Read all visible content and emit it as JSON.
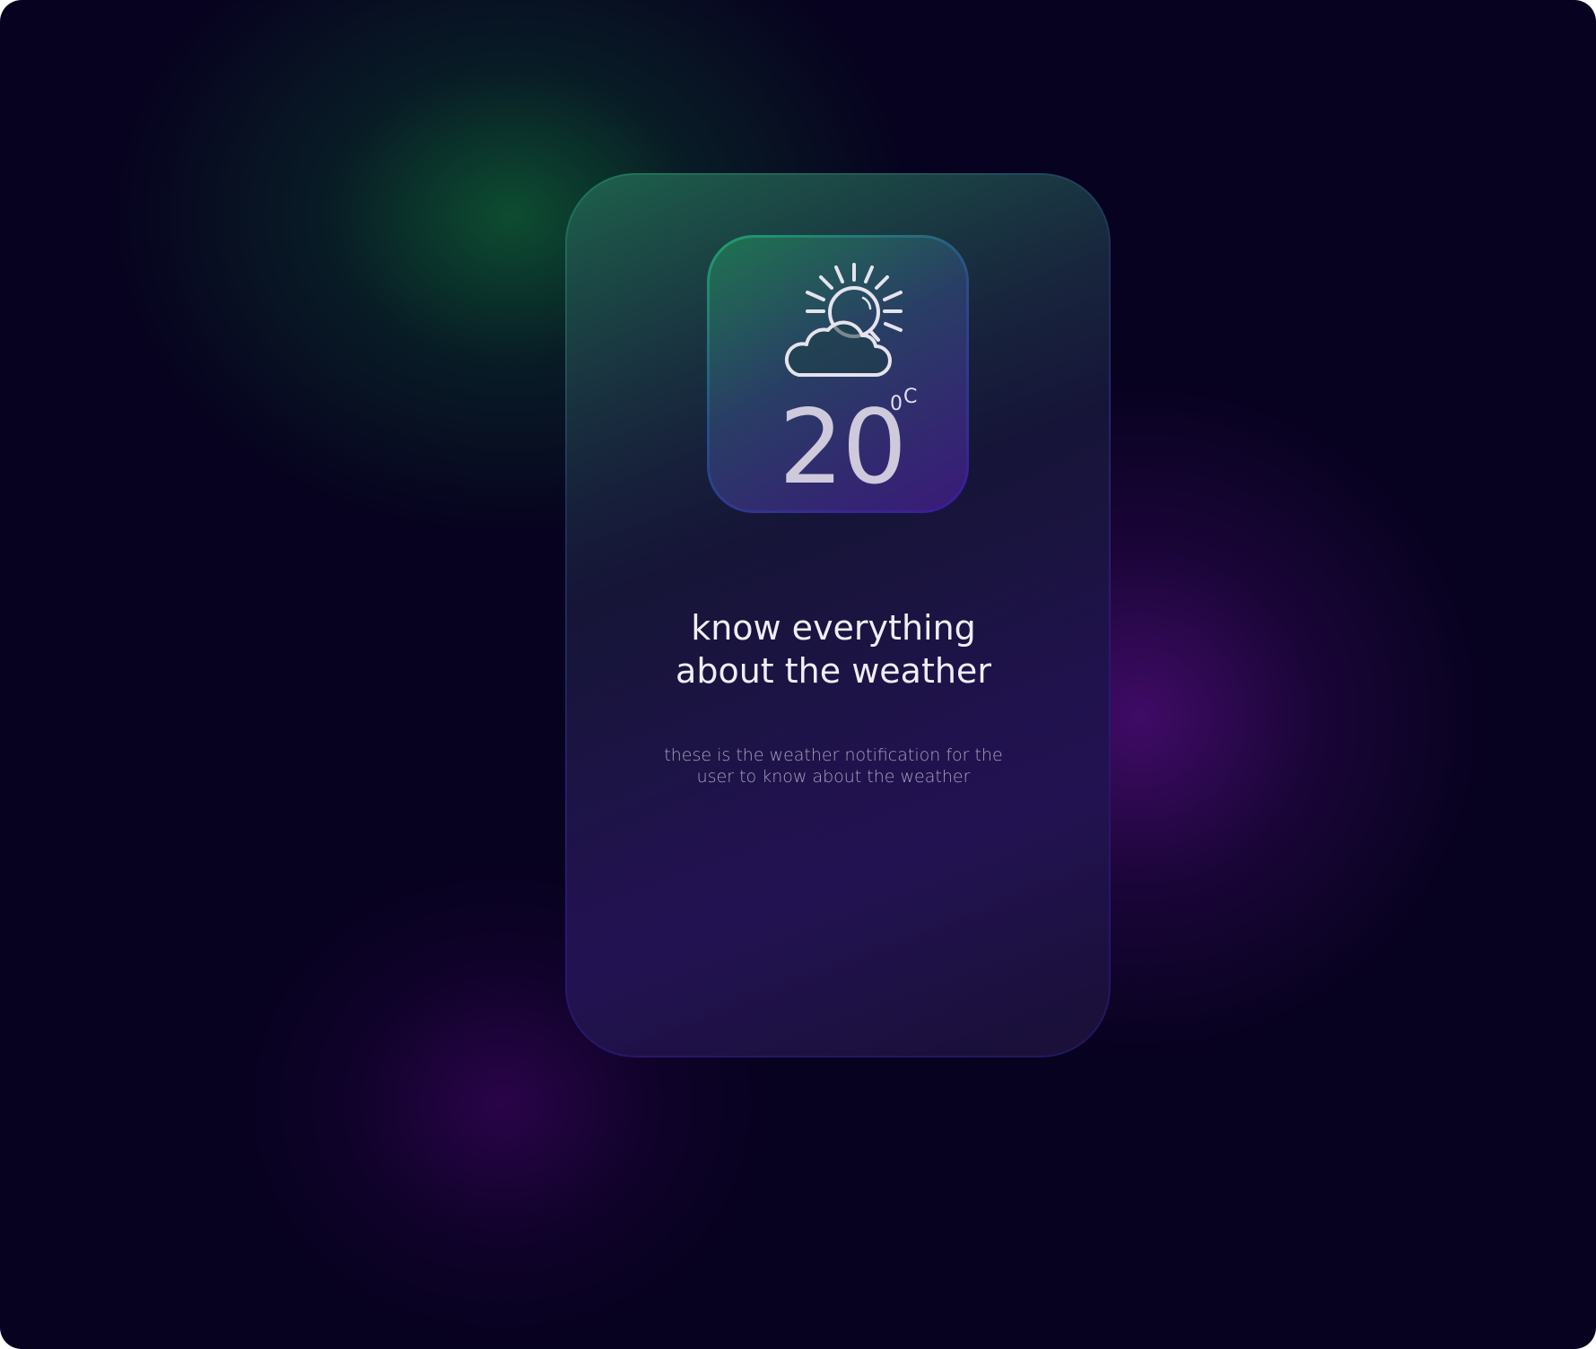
{
  "weather_card": {
    "icon": "partly-cloudy-sun-icon",
    "temperature": "20",
    "unit_degree": "0",
    "unit_scale": "C",
    "title_line1": "know everything",
    "title_line2": "about the weather",
    "description_line1": "these is the weather notification for the",
    "description_line2": "user to know about the weather"
  },
  "colors": {
    "background": "#07021f",
    "accent_green": "#21a06c",
    "accent_purple": "#3a1a9a",
    "text_primary": "#f0edf7",
    "text_secondary": "#a7a0bd"
  }
}
